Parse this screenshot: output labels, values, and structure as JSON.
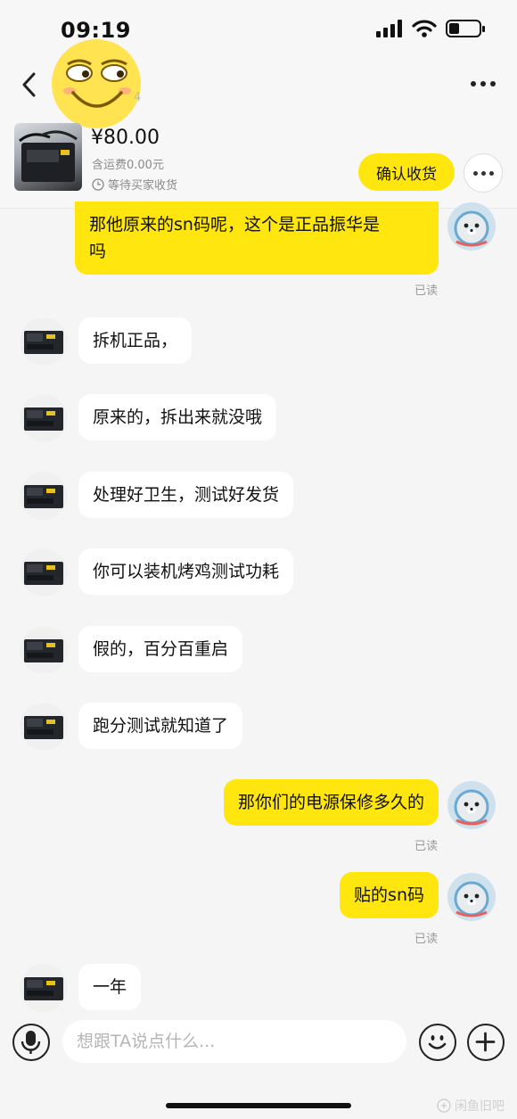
{
  "status_bar": {
    "time": "09:19",
    "battery_level": 0.35
  },
  "header": {
    "title_suffix": "4"
  },
  "product": {
    "price": "¥80.00",
    "shipping": "含运费0.00元",
    "status": "等待买家收货",
    "confirm_label": "确认收货"
  },
  "messages": [
    {
      "from": "me",
      "lines": [
        "那他原来的sn码呢，这个是正品振华是",
        "吗"
      ],
      "read": "已读"
    },
    {
      "from": "seller",
      "text": "拆机正品，"
    },
    {
      "from": "seller",
      "text": "原来的，拆出来就没哦"
    },
    {
      "from": "seller",
      "text": "处理好卫生，测试好发货"
    },
    {
      "from": "seller",
      "text": "你可以装机烤鸡测试功耗"
    },
    {
      "from": "seller",
      "text": "假的，百分百重启"
    },
    {
      "from": "seller",
      "text": "跑分测试就知道了"
    },
    {
      "from": "me",
      "text": "那你们的电源保修多久的",
      "read": "已读"
    },
    {
      "from": "me",
      "text": "贴的sn码",
      "read": "已读"
    },
    {
      "from": "seller",
      "text": "一年"
    }
  ],
  "input": {
    "placeholder": "想跟TA说点什么..."
  },
  "watermark": "闲鱼旧吧",
  "colors": {
    "accent": "#ffe60f",
    "background": "#f5f5f5"
  }
}
